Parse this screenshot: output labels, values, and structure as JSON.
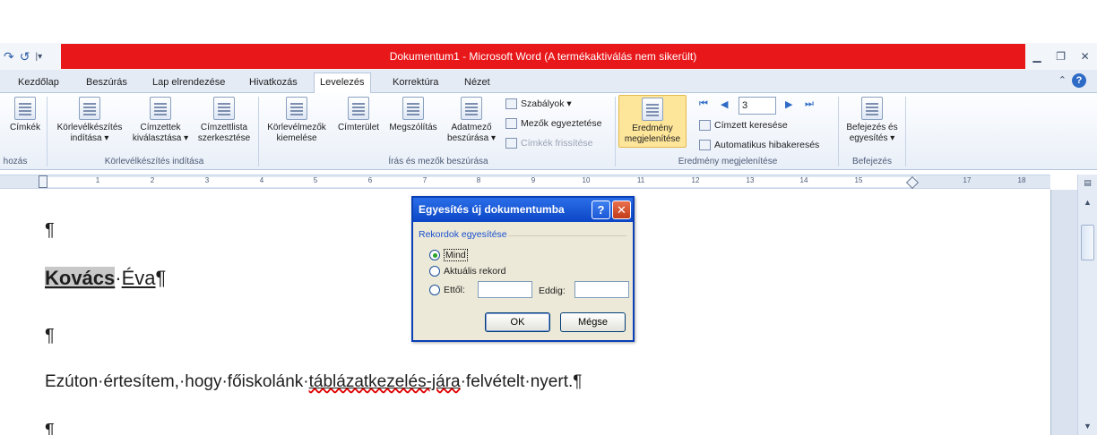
{
  "titlebar": {
    "title": "Dokumentum1  -  Microsoft Word (A termékaktiválás nem sikerült)",
    "minimize_icon": "minimize-icon",
    "restore_icon": "restore-icon",
    "close_icon": "close-icon"
  },
  "tabs": [
    "Kezdőlap",
    "Beszúrás",
    "Lap elrendezése",
    "Hivatkozás",
    "Levelezés",
    "Korrektúra",
    "Nézet"
  ],
  "active_tab": "Levelezés",
  "ribbon": {
    "buttons": {
      "labels": "Címkék",
      "start_merge_1": "Körlevélkészítés",
      "start_merge_2": "indítása ▾",
      "select_recipients_1": "Címzettek",
      "select_recipients_2": "kiválasztása ▾",
      "edit_list_1": "Címzettlista",
      "edit_list_2": "szerkesztése",
      "highlight_1": "Körlevélmezők",
      "highlight_2": "kiemelése",
      "address_block": "Címterület",
      "greeting": "Megszólítás",
      "insert_field_1": "Adatmező",
      "insert_field_2": "beszúrása ▾",
      "rules": "Szabályok ▾",
      "match_fields": "Mezők egyeztetése",
      "update_labels": "Címkék frissítése",
      "preview_1": "Eredmény",
      "preview_2": "megjelenítése",
      "find_recipient": "Címzett keresése",
      "auto_check": "Automatikus hibakeresés",
      "finish_1": "Befejezés és",
      "finish_2": "egyesítés ▾"
    },
    "record_number": "3",
    "groups": {
      "create": "hozás",
      "start": "Körlevélkészítés indítása",
      "write": "Írás és mezők beszúrása",
      "preview": "Eredmény megjelenítése",
      "finish": "Befejezés"
    }
  },
  "ruler": [
    "1",
    "2",
    "3",
    "4",
    "5",
    "6",
    "7",
    "8",
    "9",
    "10",
    "11",
    "12",
    "13",
    "14",
    "15",
    "17",
    "18"
  ],
  "document": {
    "pilcrow": "¶",
    "last_name": "Kovács",
    "first_name": "Éva",
    "body_start": "Ezúton·értesítem,·hogy·főiskolánk·",
    "body_spell": "táblázatkezelés-jára",
    "body_end": "·felvételt·nyert.¶"
  },
  "dialog": {
    "title": "Egyesítés új dokumentumba",
    "help_label": "?",
    "close_label": "✕",
    "section": "Rekordok egyesítése",
    "option_all": "Mind",
    "option_current": "Aktuális rekord",
    "option_from": "Ettől:",
    "to_label": "Eddig:",
    "from_value": "",
    "to_value": "",
    "ok": "OK",
    "cancel": "Mégse"
  }
}
